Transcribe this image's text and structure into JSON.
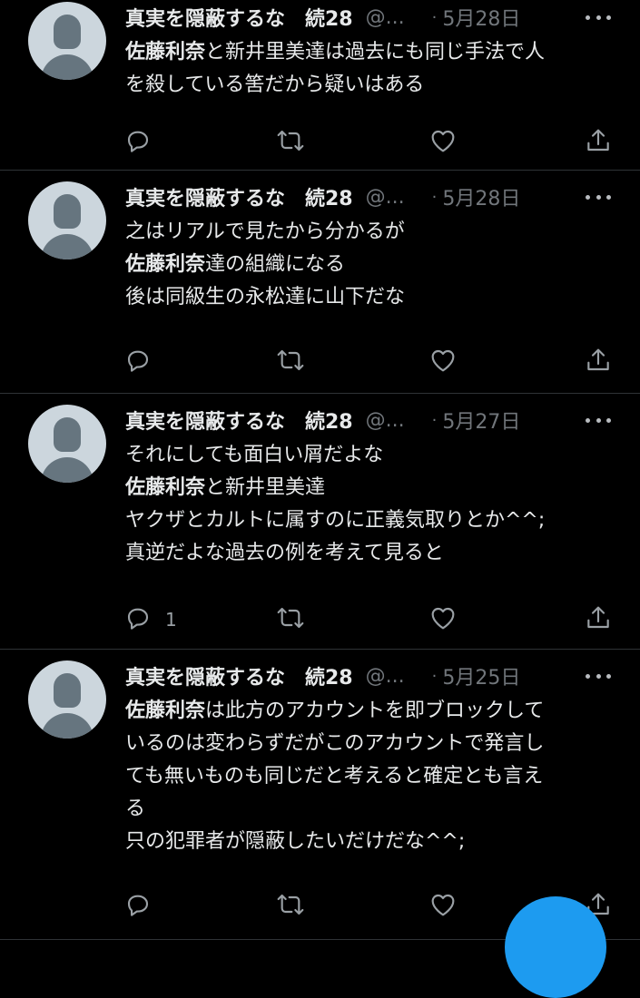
{
  "tweets": [
    {
      "name": "真実を隠蔽するな　続28",
      "handle": "@...",
      "date": "5月28日",
      "lines": [
        {
          "bold": "佐藤利奈",
          "rest": "と新井里美達は過去にも同じ手法で人"
        },
        {
          "bold": "",
          "rest": "を殺している筈だから疑いはある"
        }
      ],
      "reply_count": ""
    },
    {
      "name": "真実を隠蔽するな　続28",
      "handle": "@...",
      "date": "5月28日",
      "lines": [
        {
          "bold": "",
          "rest": "之はリアルで見たから分かるが"
        },
        {
          "bold": "佐藤利奈",
          "rest": "達の組織になる"
        },
        {
          "bold": "",
          "rest": "後は同級生の永松達に山下だな"
        }
      ],
      "reply_count": ""
    },
    {
      "name": "真実を隠蔽するな　続28",
      "handle": "@...",
      "date": "5月27日",
      "lines": [
        {
          "bold": "",
          "rest": "それにしても面白い屑だよな"
        },
        {
          "bold": "佐藤利奈",
          "rest": "と新井里美達"
        },
        {
          "bold": "",
          "rest": "ヤクザとカルトに属すのに正義気取りとか^^;"
        },
        {
          "bold": "",
          "rest": "真逆だよな過去の例を考えて見ると"
        }
      ],
      "reply_count": "1"
    },
    {
      "name": "真実を隠蔽するな　続28",
      "handle": "@...",
      "date": "5月25日",
      "lines": [
        {
          "bold": "佐藤利奈",
          "rest": "は此方のアカウントを即ブロックして"
        },
        {
          "bold": "",
          "rest": "いるのは変わらずだがこのアカウントで発言し"
        },
        {
          "bold": "",
          "rest": "ても無いものも同じだと考えると確定とも言え"
        },
        {
          "bold": "",
          "rest": "る"
        },
        {
          "bold": "",
          "rest": "只の犯罪者が隠蔽したいだけだな^^;"
        }
      ],
      "reply_count": ""
    }
  ],
  "icons": {
    "reply": "reply-icon",
    "retweet": "retweet-icon",
    "like": "heart-icon",
    "share": "share-icon",
    "more": "more-icon"
  },
  "colors": {
    "background": "#000000",
    "text": "#e7e9ea",
    "secondary": "#71767b",
    "avatar_bg": "#ccd6dd",
    "avatar_fg": "#66757f",
    "accent": "#1d9bf0"
  }
}
